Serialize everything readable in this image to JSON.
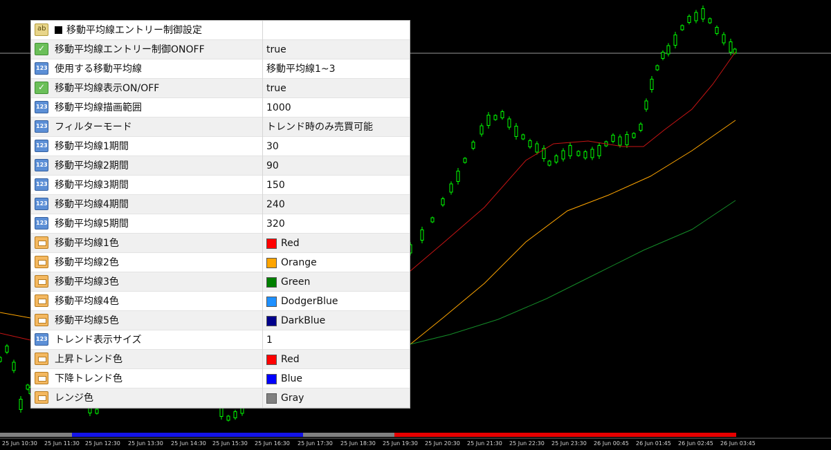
{
  "colors": {
    "background": "#000000",
    "candle": "#00ff00",
    "ma_red": "#c81414",
    "ma_orange": "#ffa500",
    "ma_green": "#148c28",
    "trend_gray": "#808080",
    "trend_blue": "#1414e6",
    "trend_red": "#e60000"
  },
  "panel": {
    "title": "移動平均線エントリー制御設定",
    "rows": [
      {
        "icon": "bool-icon",
        "label": "移動平均線エントリー制御ONOFF",
        "value": "true"
      },
      {
        "icon": "number-icon",
        "label": "使用する移動平均線",
        "value": "移動平均線1~3"
      },
      {
        "icon": "bool-icon",
        "label": "移動平均線表示ON/OFF",
        "value": "true"
      },
      {
        "icon": "number-icon",
        "label": "移動平均線描画範囲",
        "value": "1000"
      },
      {
        "icon": "number-icon",
        "label": "フィルターモード",
        "value": "トレンド時のみ売買可能"
      },
      {
        "icon": "number-icon",
        "label": "移動平均線1期間",
        "value": "30"
      },
      {
        "icon": "number-icon",
        "label": "移動平均線2期間",
        "value": "90"
      },
      {
        "icon": "number-icon",
        "label": "移動平均線3期間",
        "value": "150"
      },
      {
        "icon": "number-icon",
        "label": "移動平均線4期間",
        "value": "240"
      },
      {
        "icon": "number-icon",
        "label": "移動平均線5期間",
        "value": "320"
      },
      {
        "icon": "color-icon",
        "label": "移動平均線1色",
        "value": "Red",
        "swatch": "#ff0000"
      },
      {
        "icon": "color-icon",
        "label": "移動平均線2色",
        "value": "Orange",
        "swatch": "#ffa500"
      },
      {
        "icon": "color-icon",
        "label": "移動平均線3色",
        "value": "Green",
        "swatch": "#008000"
      },
      {
        "icon": "color-icon",
        "label": "移動平均線4色",
        "value": "DodgerBlue",
        "swatch": "#1e90ff"
      },
      {
        "icon": "color-icon",
        "label": "移動平均線5色",
        "value": "DarkBlue",
        "swatch": "#00008b"
      },
      {
        "icon": "number-icon",
        "label": "トレンド表示サイズ",
        "value": "1"
      },
      {
        "icon": "color-icon",
        "label": "上昇トレンド色",
        "value": "Red",
        "swatch": "#ff0000"
      },
      {
        "icon": "color-icon",
        "label": "下降トレンド色",
        "value": "Blue",
        "swatch": "#0000ff"
      },
      {
        "icon": "color-icon",
        "label": "レンジ色",
        "value": "Gray",
        "swatch": "#808080"
      }
    ]
  },
  "time_axis": {
    "labels": [
      "25 Jun 10:30",
      "25 Jun 11:30",
      "25 Jun 12:30",
      "25 Jun 13:30",
      "25 Jun 14:30",
      "25 Jun 15:30",
      "25 Jun 16:30",
      "25 Jun 17:30",
      "25 Jun 18:30",
      "25 Jun 19:30",
      "25 Jun 20:30",
      "25 Jun 21:30",
      "25 Jun 22:30",
      "25 Jun 23:30",
      "26 Jun 00:45",
      "26 Jun 01:45",
      "26 Jun 02:45",
      "26 Jun 03:45"
    ]
  }
}
